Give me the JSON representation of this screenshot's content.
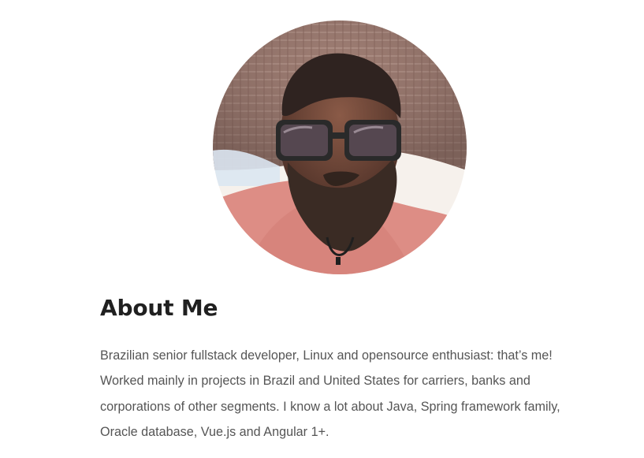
{
  "profile": {
    "avatar_label": "profile photo"
  },
  "about": {
    "title": "About Me",
    "body": "Brazilian senior fullstack developer, Linux and opensource enthusiast: that’s me! Worked mainly in projects in Brazil and United States for carriers, banks and corporations of other segments. I know a lot about Java, Spring framework family, Oracle database, Vue.js and Angular 1+."
  },
  "colors": {
    "heading": "#202020",
    "body_text": "#555555",
    "hat": "#a17d73",
    "shirt": "#dd8d85",
    "skin": "#7a4b3a",
    "beard": "#3a2b24",
    "glasses": "#2a2a2a"
  }
}
